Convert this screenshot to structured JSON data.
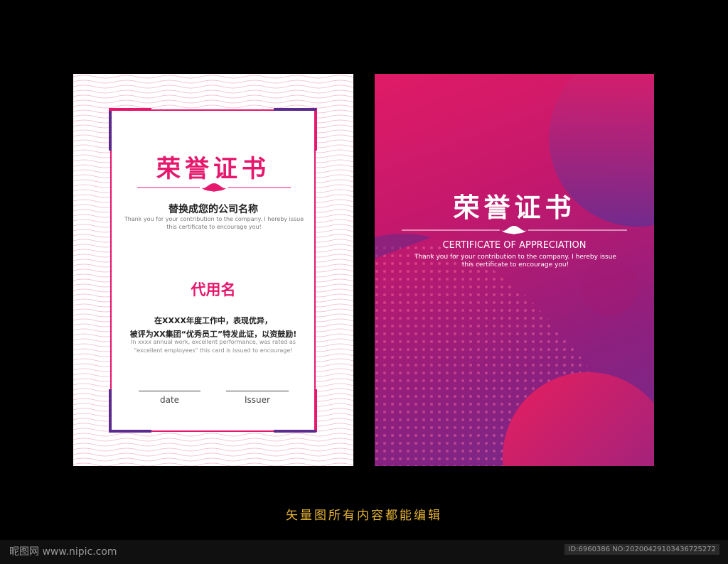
{
  "certificate_left": {
    "title": "荣誉证书",
    "company": "替换成您的公司名称",
    "thanks_en": "Thank you for your contribution to the company. I hereby issue this certificate to encourage you!",
    "recipient": "代用名",
    "award_zh_line1": "在XXXX年度工作中，表现优异，",
    "award_zh_line2": "被评为XX集团“优秀员工”特发此证，以资鼓励!",
    "award_en": "In xxxx annual work, excellent performance, was rated as \"excellent employees\" this card is issued to encourage!",
    "date_label": "date",
    "issuer_label": "Issuer"
  },
  "certificate_right": {
    "title": "荣誉证书",
    "subtitle": "CERTIFICATE OF APPRECIATION",
    "thanks_en": "Thank you for your contribution to the company. I hereby issue this certificate to encourage you!"
  },
  "caption": "矢量图所有内容都能编辑",
  "watermark_left": "昵图网 www.nipic.com",
  "watermark_right": "ID:6960386 NO:20200429103436725272",
  "colors": {
    "accent": "#e6176c",
    "purple": "#5a2a8c",
    "caption": "#e5b233"
  }
}
